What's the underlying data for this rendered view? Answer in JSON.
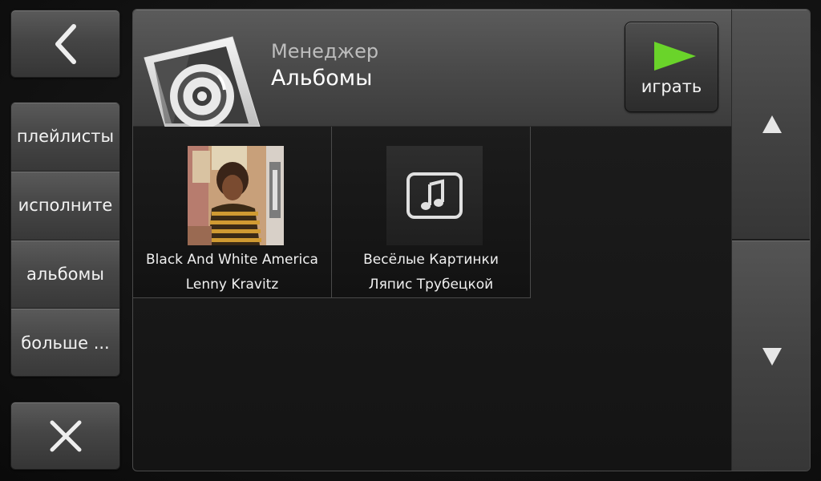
{
  "sidebar": {
    "back_icon": "chevron-left-icon",
    "items": [
      {
        "label": "плейлисты"
      },
      {
        "label": "исполните"
      },
      {
        "label": "альбомы"
      },
      {
        "label": "больше ..."
      }
    ],
    "close_icon": "close-icon"
  },
  "header": {
    "subtitle": "Менеджер",
    "title": "Альбомы",
    "icon": "disc-icon",
    "play": {
      "label": "играть",
      "icon": "play-icon",
      "color": "#6ad42a"
    }
  },
  "scroll": {
    "up_icon": "arrow-up-icon",
    "down_icon": "arrow-down-icon"
  },
  "albums": [
    {
      "title": "Black And White America",
      "artist": "Lenny Kravitz",
      "cover": "album-art"
    },
    {
      "title": "Весёлые Картинки",
      "artist": "Ляпис Трубецкой",
      "cover": "music-note-icon"
    }
  ]
}
